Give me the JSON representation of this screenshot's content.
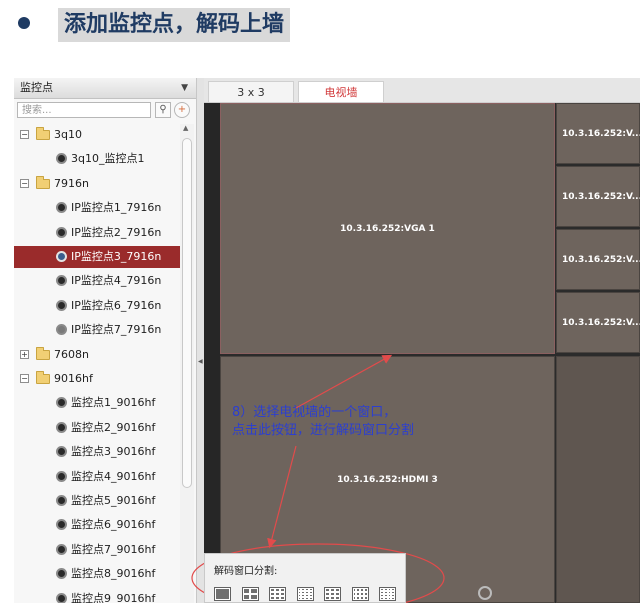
{
  "slide": {
    "title": "添加监控点，解码上墙"
  },
  "sidebar": {
    "header": "监控点",
    "search_placeholder": "搜索...",
    "tree": [
      {
        "type": "group",
        "label": "3q10",
        "expanded": true
      },
      {
        "type": "camera",
        "label": "3q10_监控点1"
      },
      {
        "type": "group",
        "label": "7916n",
        "expanded": true
      },
      {
        "type": "camera",
        "label": "IP监控点1_7916n"
      },
      {
        "type": "camera",
        "label": "IP监控点2_7916n"
      },
      {
        "type": "camera",
        "label": "IP监控点3_7916n",
        "selected": true
      },
      {
        "type": "camera",
        "label": "IP监控点4_7916n"
      },
      {
        "type": "camera",
        "label": "IP监控点6_7916n"
      },
      {
        "type": "camera",
        "label": "IP监控点7_7916n",
        "offline": true
      },
      {
        "type": "group",
        "label": "7608n",
        "expanded": false
      },
      {
        "type": "group",
        "label": "9016hf",
        "expanded": true
      },
      {
        "type": "camera",
        "label": "监控点1_9016hf"
      },
      {
        "type": "camera",
        "label": "监控点2_9016hf"
      },
      {
        "type": "camera",
        "label": "监控点3_9016hf"
      },
      {
        "type": "camera",
        "label": "监控点4_9016hf"
      },
      {
        "type": "camera",
        "label": "监控点5_9016hf"
      },
      {
        "type": "camera",
        "label": "监控点6_9016hf"
      },
      {
        "type": "camera",
        "label": "监控点7_9016hf"
      },
      {
        "type": "camera",
        "label": "监控点8_9016hf"
      },
      {
        "type": "camera",
        "label": "监控点9_9016hf"
      }
    ]
  },
  "main": {
    "tabs": [
      {
        "label": "3 x 3"
      },
      {
        "label": "电视墙",
        "active": true
      }
    ],
    "screens": {
      "vga1": "10.3.16.252:VGA 1",
      "hdmi3": "10.3.16.252:HDMI 3",
      "right": [
        "10.3.16.252:V...",
        "10.3.16.252:V...",
        "10.3.16.252:V...",
        "10.3.16.252:V..."
      ]
    }
  },
  "annotation": {
    "text": "8）选择电视墙的一个窗口，\n点击此按钮，进行解码窗口分割",
    "color": "#2c3fcf"
  },
  "popup": {
    "label": "解码窗口分割:",
    "split_buttons": [
      {
        "grid": "1x1"
      },
      {
        "grid": "2x2"
      },
      {
        "grid": "1+5"
      },
      {
        "grid": "1+7"
      },
      {
        "grid": "3x3"
      },
      {
        "grid": "4x3"
      },
      {
        "grid": "4x4"
      }
    ]
  },
  "colors": {
    "accent": "#9a2b2b",
    "active_tab_text": "#d1393a",
    "screen_bg": "#6e645d",
    "annotation_arrow": "#e24b4b"
  }
}
